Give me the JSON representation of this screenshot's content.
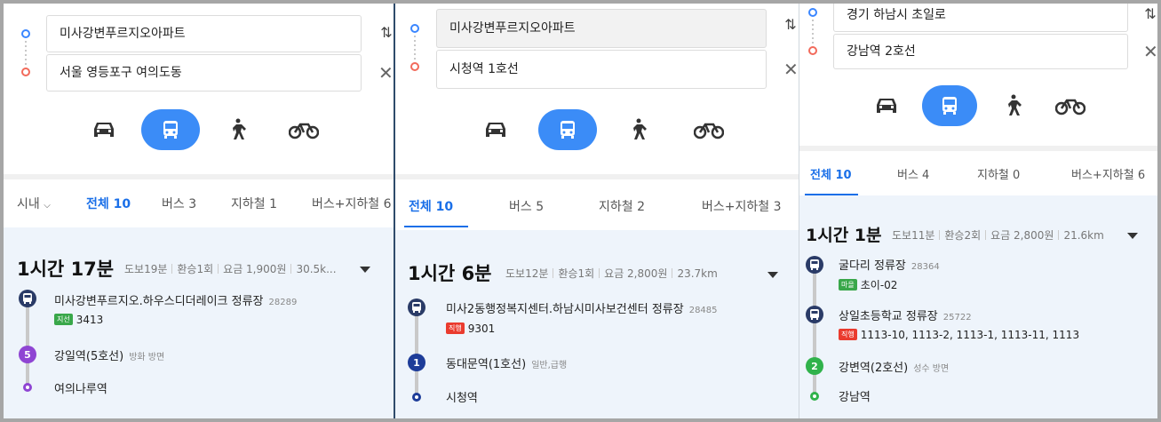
{
  "colors": {
    "accent": "#3b8cf7",
    "tab_active": "#1a6fe8",
    "bus_navy": "#2a3b67",
    "line5_purple": "#8f45d3",
    "line1_navy": "#1d3c99",
    "line2_green": "#30b24b",
    "badge_green": "#39a74a",
    "badge_red": "#ea3b2e",
    "result_bg": "#eef4fb"
  },
  "panel1": {
    "origin": "미사강변푸르지오아파트",
    "destination": "서울 영등포구 여의도동",
    "region": "시내",
    "tabs": [
      "전체 10",
      "버스 3",
      "지하철 1",
      "버스+지하철 6"
    ],
    "route": {
      "time": "1시간 17분",
      "walk": "도보19분",
      "transfers": "환승1회",
      "fare": "요금 1,900원",
      "distance": "30.5k...",
      "steps": [
        {
          "name": "미사강변푸르지오.하우스디더레이크 정류장",
          "sub": "28289",
          "badge": "지선",
          "lines": "3413"
        },
        {
          "name": "강일역(5호선)",
          "sub": "방화 방면",
          "icon_text": "5"
        },
        {
          "name": "여의나루역"
        }
      ]
    }
  },
  "panel2": {
    "origin": "미사강변푸르지오아파트",
    "destination": "시청역 1호선",
    "tabs": [
      "전체 10",
      "버스 5",
      "지하철 2",
      "버스+지하철 3"
    ],
    "route": {
      "time": "1시간 6분",
      "walk": "도보12분",
      "transfers": "환승1회",
      "fare": "요금 2,800원",
      "distance": "23.7km",
      "steps": [
        {
          "name": "미사2동행정복지센터.하남시미사보건센터 정류장",
          "sub": "28485",
          "badge": "직행",
          "lines": "9301"
        },
        {
          "name": "동대문역(1호선)",
          "sub": "일반,급행",
          "icon_text": "1"
        },
        {
          "name": "시청역"
        }
      ]
    }
  },
  "panel3": {
    "origin": "경기 하남시 초일로",
    "destination": "강남역 2호선",
    "tabs": [
      "전체 10",
      "버스 4",
      "지하철 0",
      "버스+지하철 6"
    ],
    "route": {
      "time": "1시간 1분",
      "walk": "도보11분",
      "transfers": "환승2회",
      "fare": "요금 2,800원",
      "distance": "21.6km",
      "steps": [
        {
          "name": "굴다리 정류장",
          "sub": "28364",
          "badge": "마을",
          "lines": "초이-02"
        },
        {
          "name": "상일초등학교 정류장",
          "sub": "25722",
          "badge": "직행",
          "lines": "1113-10, 1113-2, 1113-1, 1113-11, 1113"
        },
        {
          "name": "강변역(2호선)",
          "sub": "성수 방면",
          "icon_text": "2"
        },
        {
          "name": "강남역"
        }
      ]
    }
  }
}
